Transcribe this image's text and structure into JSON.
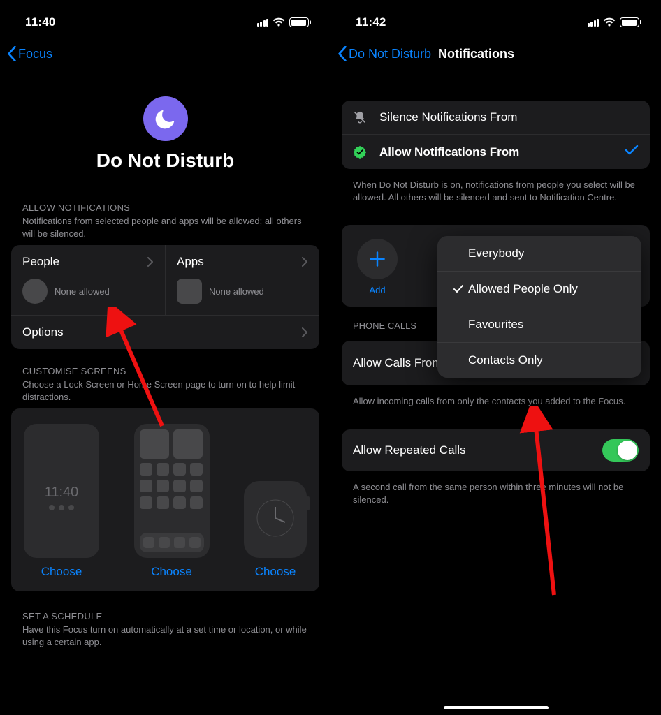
{
  "left": {
    "status": {
      "time": "11:40",
      "battery": "83",
      "batteryPct": 83
    },
    "nav": {
      "back": "Focus"
    },
    "hero": {
      "title": "Do Not Disturb"
    },
    "allow": {
      "header": "ALLOW NOTIFICATIONS",
      "desc": "Notifications from selected people and apps will be allowed; all others will be silenced.",
      "people": {
        "title": "People",
        "status": "None allowed"
      },
      "apps": {
        "title": "Apps",
        "status": "None allowed"
      },
      "options": "Options"
    },
    "customise": {
      "header": "CUSTOMISE SCREENS",
      "desc": "Choose a Lock Screen or Home Screen page to turn on to help limit distractions.",
      "lockTime": "11:40",
      "choose": "Choose"
    },
    "schedule": {
      "header": "SET A SCHEDULE",
      "desc": "Have this Focus turn on automatically at a set time or location, or while using a certain app."
    }
  },
  "right": {
    "status": {
      "time": "11:42",
      "battery": "83",
      "batteryPct": 83
    },
    "nav": {
      "back": "Do Not Disturb",
      "title": "Notifications"
    },
    "modes": {
      "silence": "Silence Notifications From",
      "allow": "Allow Notifications From",
      "footer": "When Do Not Disturb is on, notifications from people you select will be allowed. All others will be silenced and sent to Notification Centre."
    },
    "add": {
      "label": "Add"
    },
    "popover": {
      "items": [
        "Everybody",
        "Allowed People Only",
        "Favourites",
        "Contacts Only"
      ],
      "selectedIndex": 1
    },
    "phoneCalls": {
      "header": "PHONE CALLS",
      "allowCalls": {
        "label": "Allow Calls From",
        "value": "Allowed\nPeople Only"
      },
      "footer": "Allow incoming calls from only the contacts you added to the Focus.",
      "repeated": {
        "label": "Allow Repeated Calls",
        "on": true
      },
      "repeatedFooter": "A second call from the same person within three minutes will not be silenced."
    }
  }
}
